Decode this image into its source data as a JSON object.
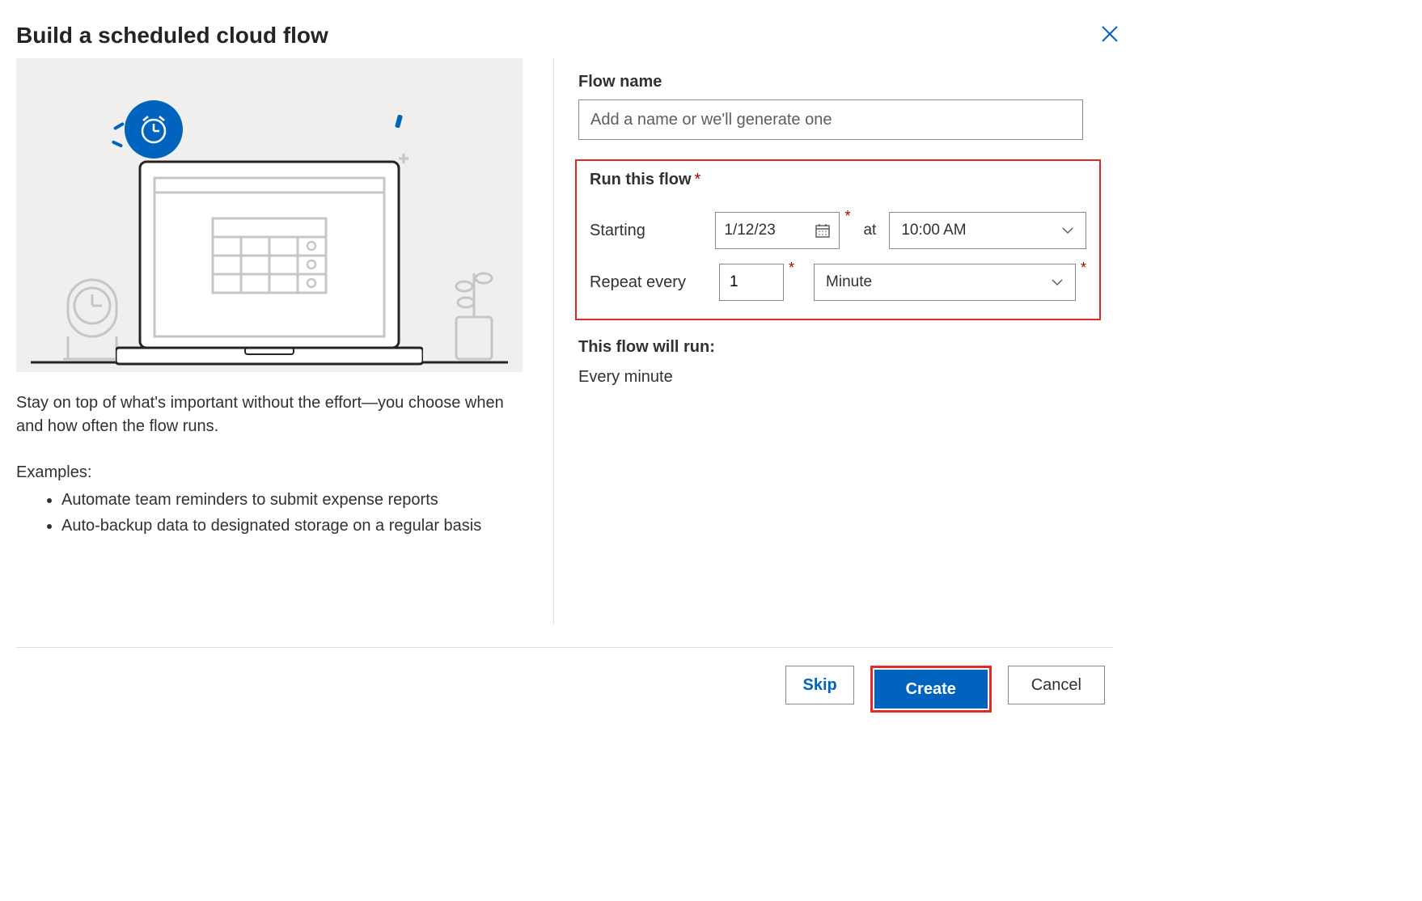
{
  "header": {
    "title": "Build a scheduled cloud flow"
  },
  "left": {
    "description": "Stay on top of what's important without the effort—you choose when and how often the flow runs.",
    "examples_label": "Examples:",
    "examples": [
      "Automate team reminders to submit expense reports",
      "Auto-backup data to designated storage on a regular basis"
    ]
  },
  "form": {
    "flow_name_label": "Flow name",
    "flow_name_placeholder": "Add a name or we'll generate one",
    "flow_name_value": "",
    "run_section_label": "Run this flow",
    "starting_label": "Starting",
    "starting_date": "1/12/23",
    "at_label": "at",
    "starting_time": "10:00 AM",
    "repeat_label": "Repeat every",
    "repeat_count": "1",
    "repeat_unit": "Minute",
    "summary_label": "This flow will run:",
    "summary_value": "Every minute"
  },
  "footer": {
    "skip": "Skip",
    "create": "Create",
    "cancel": "Cancel"
  }
}
